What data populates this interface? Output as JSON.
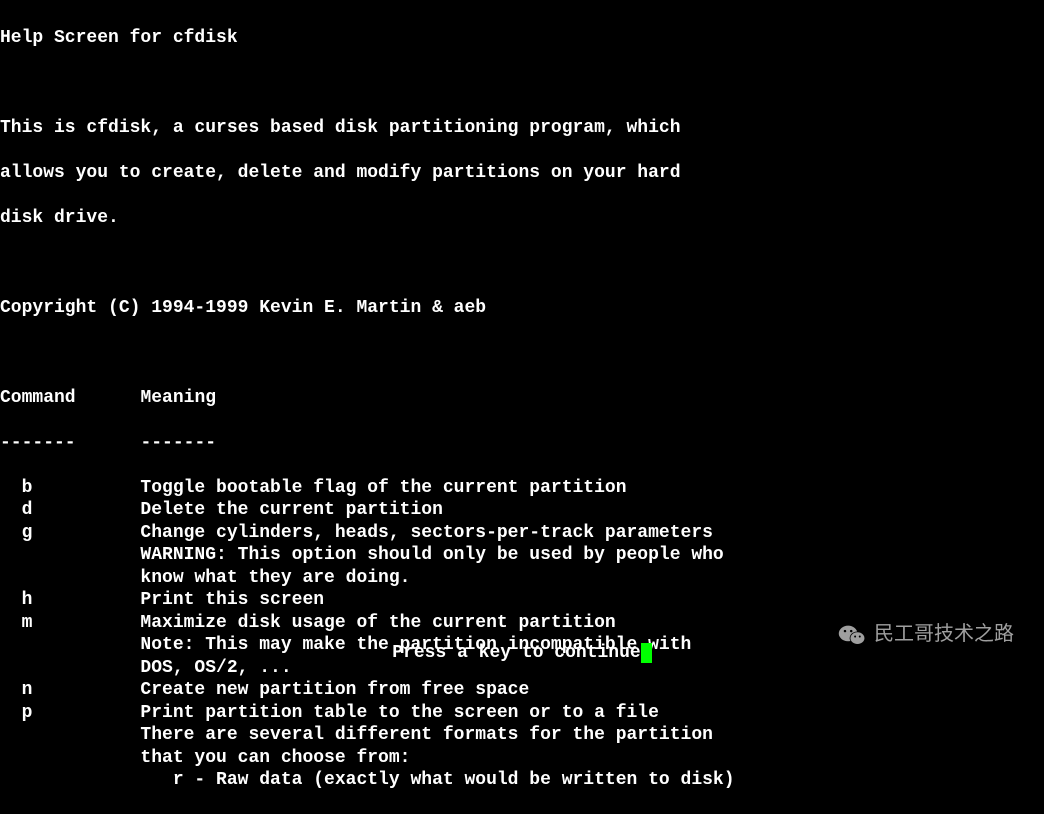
{
  "title": "Help Screen for cfdisk",
  "intro": [
    "This is cfdisk, a curses based disk partitioning program, which",
    "allows you to create, delete and modify partitions on your hard",
    "disk drive."
  ],
  "copyright": "Copyright (C) 1994-1999 Kevin E. Martin & aeb",
  "header_command": "Command",
  "header_meaning": "Meaning",
  "header_sep": "-------",
  "commands": [
    {
      "key": "b",
      "lines": [
        "Toggle bootable flag of the current partition"
      ]
    },
    {
      "key": "d",
      "lines": [
        "Delete the current partition"
      ]
    },
    {
      "key": "g",
      "lines": [
        "Change cylinders, heads, sectors-per-track parameters",
        "WARNING: This option should only be used by people who",
        "know what they are doing."
      ]
    },
    {
      "key": "h",
      "lines": [
        "Print this screen"
      ]
    },
    {
      "key": "m",
      "lines": [
        "Maximize disk usage of the current partition",
        "Note: This may make the partition incompatible with",
        "DOS, OS/2, ..."
      ]
    },
    {
      "key": "n",
      "lines": [
        "Create new partition from free space"
      ]
    },
    {
      "key": "p",
      "lines": [
        "Print partition table to the screen or to a file",
        "There are several different formats for the partition",
        "that you can choose from:",
        "   r - Raw data (exactly what would be written to disk)"
      ]
    }
  ],
  "footer": "Press a key to continue",
  "watermark": "民工哥技术之路"
}
